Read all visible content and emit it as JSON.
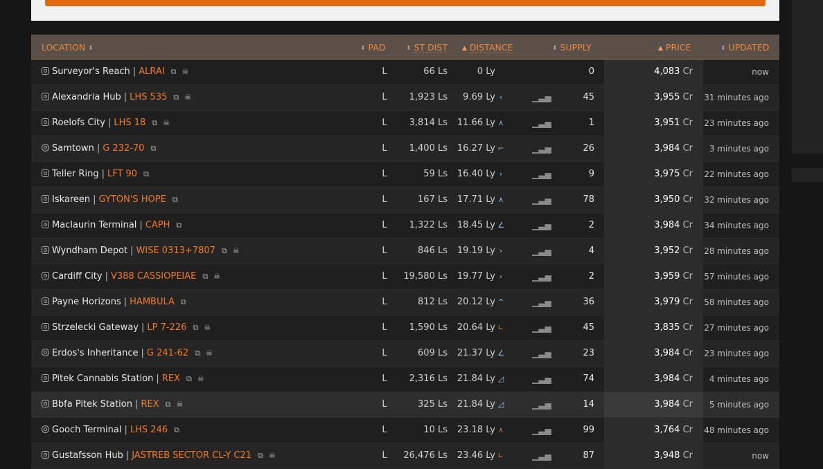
{
  "headers": {
    "location": "LOCATION",
    "pad": "PAD",
    "st_dist": "ST DIST",
    "distance": "DISTANCE",
    "supply": "SUPPLY",
    "price": "PRICE",
    "updated": "UPDATED"
  },
  "rows": [
    {
      "station": "Surveyor's Reach",
      "system": "ALRAI",
      "pad": "L",
      "st_dist": "66 Ls",
      "distance": "0 Ly",
      "arrow": "",
      "supply": "0",
      "price": "4,083",
      "price_unit": "Cr",
      "updated": "now"
    },
    {
      "station": "Alexandria Hub",
      "system": "LHS 535",
      "pad": "L",
      "st_dist": "1,923 Ls",
      "distance": "9.69 Ly",
      "arrow": "‹",
      "supply": "45",
      "price": "3,955",
      "price_unit": "Cr",
      "updated": "31 minutes ago"
    },
    {
      "station": "Roelofs City",
      "system": "LHS 18",
      "pad": "L",
      "st_dist": "3,814 Ls",
      "distance": "11.66 Ly",
      "arrow": "⋏",
      "supply": "1",
      "price": "3,951",
      "price_unit": "Cr",
      "updated": "23 minutes ago"
    },
    {
      "station": "Samtown",
      "system": "G 232-70",
      "pad": "L",
      "st_dist": "1,400 Ls",
      "distance": "16.27 Ly",
      "arrow": "⌐",
      "supply": "26",
      "price": "3,984",
      "price_unit": "Cr",
      "updated": "3 minutes ago"
    },
    {
      "station": "Teller Ring",
      "system": "LFT 90",
      "pad": "L",
      "st_dist": "59 Ls",
      "distance": "16.40 Ly",
      "arrow": "›",
      "supply": "9",
      "price": "3,975",
      "price_unit": "Cr",
      "updated": "22 minutes ago"
    },
    {
      "station": "Iskareen",
      "system": "GYTON'S HOPE",
      "pad": "L",
      "st_dist": "167 Ls",
      "distance": "17.71 Ly",
      "arrow": "⋏",
      "supply": "78",
      "price": "3,950",
      "price_unit": "Cr",
      "updated": "32 minutes ago"
    },
    {
      "station": "Maclaurin Terminal",
      "system": "CAPH",
      "pad": "L",
      "st_dist": "1,322 Ls",
      "distance": "18.45 Ly",
      "arrow": "∠",
      "supply": "2",
      "price": "3,984",
      "price_unit": "Cr",
      "updated": "34 minutes ago"
    },
    {
      "station": "Wyndham Depot",
      "system": "WISE 0313+7807",
      "pad": "L",
      "st_dist": "846 Ls",
      "distance": "19.19 Ly",
      "arrow": "›",
      "supply": "4",
      "price": "3,952",
      "price_unit": "Cr",
      "updated": "28 minutes ago"
    },
    {
      "station": "Cardiff City",
      "system": "V388 CASSIOPEIAE",
      "pad": "L",
      "st_dist": "19,580 Ls",
      "distance": "19.77 Ly",
      "arrow": "›",
      "supply": "2",
      "price": "3,959",
      "price_unit": "Cr",
      "updated": "57 minutes ago"
    },
    {
      "station": "Payne Horizons",
      "system": "HAMBULA",
      "pad": "L",
      "st_dist": "812 Ls",
      "distance": "20.12 Ly",
      "arrow": "^",
      "supply": "36",
      "price": "3,979",
      "price_unit": "Cr",
      "updated": "58 minutes ago"
    },
    {
      "station": "Strzelecki Gateway",
      "system": "LP 7-226",
      "pad": "L",
      "st_dist": "1,590 Ls",
      "distance": "20.64 Ly",
      "arrow": "∟",
      "supply": "45",
      "price": "3,835",
      "price_unit": "Cr",
      "updated": "27 minutes ago"
    },
    {
      "station": "Erdos's Inheritance",
      "system": "G 241-62",
      "pad": "L",
      "st_dist": "609 Ls",
      "distance": "21.37 Ly",
      "arrow": "∠",
      "supply": "23",
      "price": "3,984",
      "price_unit": "Cr",
      "updated": "23 minutes ago"
    },
    {
      "station": "Pitek Cannabis Station",
      "system": "REX",
      "pad": "L",
      "st_dist": "2,316 Ls",
      "distance": "21.84 Ly",
      "arrow": "◿",
      "supply": "74",
      "price": "3,984",
      "price_unit": "Cr",
      "updated": "4 minutes ago"
    },
    {
      "station": "Bbfa Pitek Station",
      "system": "REX",
      "pad": "L",
      "st_dist": "325 Ls",
      "distance": "21.84 Ly",
      "arrow": "◿",
      "supply": "14",
      "price": "3,984",
      "price_unit": "Cr",
      "updated": "5 minutes ago"
    },
    {
      "station": "Gooch Terminal",
      "system": "LHS 246",
      "pad": "L",
      "st_dist": "10 Ls",
      "distance": "23.18 Ly",
      "arrow": "⋏",
      "supply": "99",
      "price": "3,764",
      "price_unit": "Cr",
      "updated": "48 minutes ago"
    },
    {
      "station": "Gustafsson Hub",
      "system": "JASTREB SECTOR CL-Y C21",
      "pad": "L",
      "st_dist": "26,476 Ls",
      "distance": "23.46 Ly",
      "arrow": "∟",
      "supply": "87",
      "price": "3,948",
      "price_unit": "Cr",
      "updated": "now"
    }
  ],
  "icons": {
    "external_link": "external-link-icon",
    "skull": "skull-icon",
    "station": "station-icon",
    "bars": "market-bars-icon"
  }
}
